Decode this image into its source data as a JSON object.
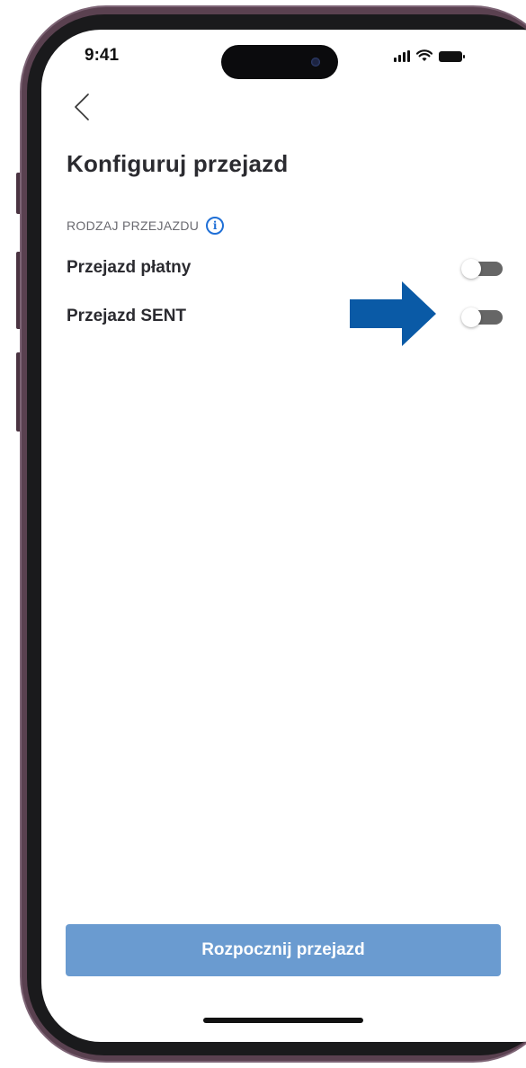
{
  "status_bar": {
    "time": "9:41",
    "icons": [
      "signal-icon",
      "wifi-icon",
      "battery-icon"
    ]
  },
  "header": {
    "back_icon": "chevron-left-icon",
    "title": "Konfiguruj przejazd"
  },
  "section": {
    "label": "RODZAJ PRZEJAZDU",
    "info_icon": "info-icon",
    "info_glyph": "i"
  },
  "options": [
    {
      "label": "Przejazd płatny",
      "enabled": false
    },
    {
      "label": "Przejazd SENT",
      "enabled": false
    }
  ],
  "annotation": {
    "icon": "arrow-right-icon",
    "color": "#0a5aa6"
  },
  "footer": {
    "start_label": "Rozpocznij przejazd"
  },
  "colors": {
    "accent": "#1f6fd6",
    "button_bg": "#6a9bd0",
    "toggle_off": "#666666",
    "frame": "#5a4150"
  }
}
